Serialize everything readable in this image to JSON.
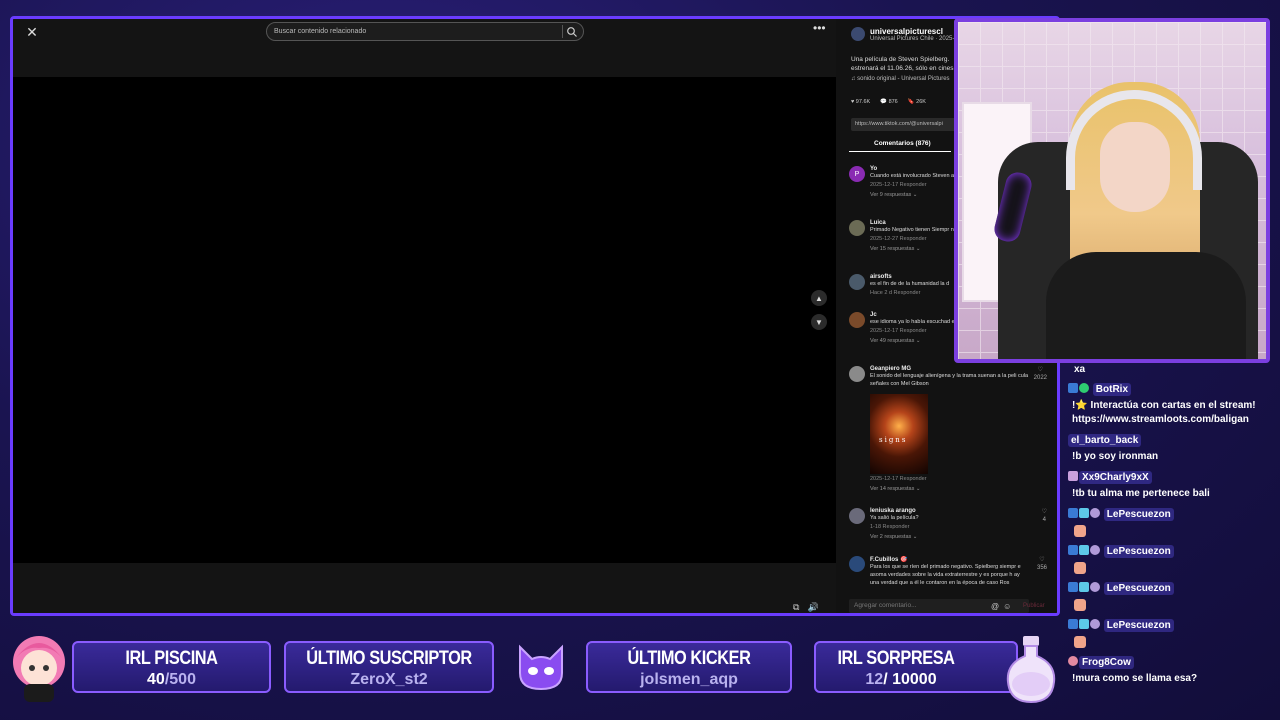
{
  "browser": {
    "search_placeholder": "Buscar contenido relacionado"
  },
  "post": {
    "account_handle": "universalpicturescl",
    "account_sub": "Universal Pictures Chile · 2025-",
    "description": "Una película de Steven Spielberg. estrenará el 11.06.26, sólo en cines",
    "sound": "♫ sonido original - Universal Pictures",
    "likes": "97.6K",
    "comments": "876",
    "saves": "26K",
    "link": "https://www.tiktok.com/@universalpi",
    "comments_tab": "Comentarios (876)",
    "add_comment_placeholder": "Agregar comentario...",
    "publish_label": "Publicar"
  },
  "comments": [
    {
      "initial": "P",
      "user": "Yo",
      "text": "Cuando está involucrado Steven a.",
      "meta": "2025-12-17   Responder",
      "replies": "Ver 9 respuestas ⌄"
    },
    {
      "initial": "",
      "user": "Luica",
      "text": "Primado Negativo tienen Siempr n nuestras narices va a ocurrir",
      "meta": "2025-12-27   Responder",
      "replies": "Ver 15 respuestas ⌄"
    },
    {
      "initial": "",
      "user": "airsofts",
      "text": "es el fin de de la humanidad la d",
      "meta": "Hace 2 d   Responder",
      "replies": ""
    },
    {
      "initial": "",
      "user": "Jc",
      "text": "ese idioma ya lo había escuchad ecuerdo ...",
      "meta": "2025-12-17   Responder",
      "replies": "Ver 49 respuestas ⌄"
    },
    {
      "initial": "",
      "user": "Geanpiero MG",
      "text": "El sonido del lenguaje alienígena y la trama suenan a la peli cula señales con Mel Gibson",
      "meta": "2025-12-17   Responder",
      "replies": "Ver 14 respuestas ⌄",
      "likes": "2022",
      "image_text": "signs"
    },
    {
      "initial": "",
      "user": "leniuska arango",
      "text": "Ya salió la película?",
      "meta": "1-18   Responder",
      "replies": "Ver 2 respuestas ⌄",
      "likes": "4"
    },
    {
      "initial": "",
      "user": "F.Cubillos 🎯",
      "text": "Para los que se ríen del primado negativo. Spielberg siempr e asoma verdades sobre la vida extraterrestre y es porque h ay una verdad que a él le contaron en la época de caso Ros",
      "meta": "",
      "replies": "",
      "likes": "356"
    }
  ],
  "chat": [
    {
      "user": "",
      "message": "xa"
    },
    {
      "user": "BotRix",
      "message": ""
    },
    {
      "user": "",
      "message": "!⭐ Interactúa con cartas en el stream!"
    },
    {
      "user": "",
      "message": "https://www.streamloots.com/baligan"
    },
    {
      "user": "el_barto_back",
      "message": ""
    },
    {
      "user": "",
      "message": "!b yo soy ironman"
    },
    {
      "user": "Xx9Charly9xX",
      "message": ""
    },
    {
      "user": "",
      "message": "!tb tu alma me pertenece bali"
    },
    {
      "user": "LePescuezon",
      "message": ""
    },
    {
      "user": "LePescuezon",
      "message": ""
    },
    {
      "user": "LePescuezon",
      "message": ""
    },
    {
      "user": "LePescuezon",
      "message": ""
    },
    {
      "user": "Frog8Cow",
      "message": ""
    },
    {
      "user": "",
      "message": "!mura como se llama esa?"
    }
  ],
  "overlay": {
    "irl_piscina": {
      "label": "IRL PISCINA",
      "current": "40",
      "goal": "/500"
    },
    "ultimo_suscriptor": {
      "label": "ÚLTIMO SUSCRIPTOR",
      "value": "ZeroX_st2"
    },
    "ultimo_kicker": {
      "label": "ÚLTIMO KICKER",
      "value": "jolsmen_aqp"
    },
    "irl_sorpresa": {
      "label": "IRL SORPRESA",
      "current": "12",
      "goal": "/ 10000"
    }
  },
  "colors": {
    "accent": "#7b3fe0",
    "frame_border": "#6a3cff",
    "stat_box": "#241a6e"
  }
}
